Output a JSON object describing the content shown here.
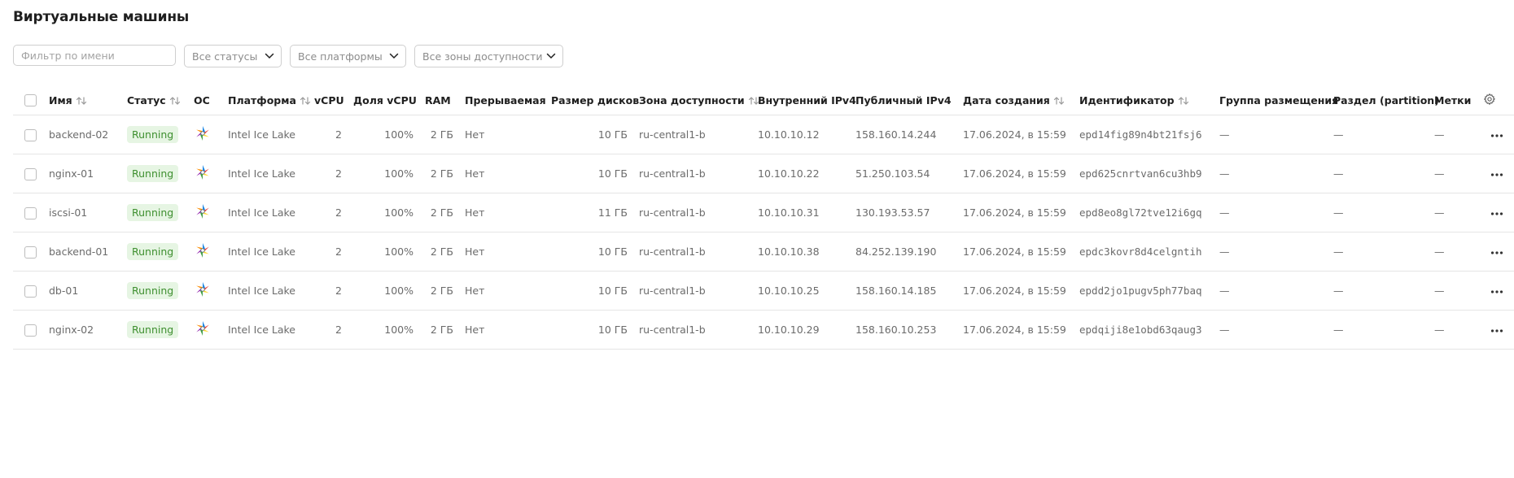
{
  "page": {
    "title": "Виртуальные машины"
  },
  "filters": {
    "name_placeholder": "Фильтр по имени",
    "status": "Все статусы",
    "platform": "Все платформы",
    "zone": "Все зоны доступности"
  },
  "columns": {
    "name": "Имя",
    "status": "Статус",
    "os": "ОС",
    "platform": "Платформа",
    "vcpu": "vCPU",
    "vcpu_share": "Доля vCPU",
    "ram": "RAM",
    "preemptible": "Прерываемая",
    "disk_size": "Размер дисков",
    "zone": "Зона доступности",
    "internal_ipv4": "Внутренний IPv4",
    "public_ipv4": "Публичный IPv4",
    "created": "Дата создания",
    "id": "Идентификатор",
    "placement_group": "Группа размещения",
    "partition": "Раздел (partition)",
    "labels": "Метки"
  },
  "rows": [
    {
      "name": "backend-02",
      "status": "Running",
      "platform": "Intel Ice Lake",
      "vcpu": "2",
      "vcpu_share": "100%",
      "ram": "2 ГБ",
      "preemptible": "Нет",
      "disk": "10 ГБ",
      "zone": "ru-central1-b",
      "internal_ip": "10.10.10.12",
      "public_ip": "158.160.14.244",
      "created": "17.06.2024, в 15:59",
      "id": "epd14fig89n4bt21fsj6",
      "placement_group": "—",
      "partition": "—",
      "labels": "—"
    },
    {
      "name": "nginx-01",
      "status": "Running",
      "platform": "Intel Ice Lake",
      "vcpu": "2",
      "vcpu_share": "100%",
      "ram": "2 ГБ",
      "preemptible": "Нет",
      "disk": "10 ГБ",
      "zone": "ru-central1-b",
      "internal_ip": "10.10.10.22",
      "public_ip": "51.250.103.54",
      "created": "17.06.2024, в 15:59",
      "id": "epd625cnrtvan6cu3hb9",
      "placement_group": "—",
      "partition": "—",
      "labels": "—"
    },
    {
      "name": "iscsi-01",
      "status": "Running",
      "platform": "Intel Ice Lake",
      "vcpu": "2",
      "vcpu_share": "100%",
      "ram": "2 ГБ",
      "preemptible": "Нет",
      "disk": "11 ГБ",
      "zone": "ru-central1-b",
      "internal_ip": "10.10.10.31",
      "public_ip": "130.193.53.57",
      "created": "17.06.2024, в 15:59",
      "id": "epd8eo8gl72tve12i6gq",
      "placement_group": "—",
      "partition": "—",
      "labels": "—"
    },
    {
      "name": "backend-01",
      "status": "Running",
      "platform": "Intel Ice Lake",
      "vcpu": "2",
      "vcpu_share": "100%",
      "ram": "2 ГБ",
      "preemptible": "Нет",
      "disk": "10 ГБ",
      "zone": "ru-central1-b",
      "internal_ip": "10.10.10.38",
      "public_ip": "84.252.139.190",
      "created": "17.06.2024, в 15:59",
      "id": "epdc3kovr8d4celgntih",
      "placement_group": "—",
      "partition": "—",
      "labels": "—"
    },
    {
      "name": "db-01",
      "status": "Running",
      "platform": "Intel Ice Lake",
      "vcpu": "2",
      "vcpu_share": "100%",
      "ram": "2 ГБ",
      "preemptible": "Нет",
      "disk": "10 ГБ",
      "zone": "ru-central1-b",
      "internal_ip": "10.10.10.25",
      "public_ip": "158.160.14.185",
      "created": "17.06.2024, в 15:59",
      "id": "epdd2jo1pugv5ph77baq",
      "placement_group": "—",
      "partition": "—",
      "labels": "—"
    },
    {
      "name": "nginx-02",
      "status": "Running",
      "platform": "Intel Ice Lake",
      "vcpu": "2",
      "vcpu_share": "100%",
      "ram": "2 ГБ",
      "preemptible": "Нет",
      "disk": "10 ГБ",
      "zone": "ru-central1-b",
      "internal_ip": "10.10.10.29",
      "public_ip": "158.160.10.253",
      "created": "17.06.2024, в 15:59",
      "id": "epdqiji8e1obd63qaug3",
      "placement_group": "—",
      "partition": "—",
      "labels": "—"
    }
  ],
  "icons": {
    "os": "os-logo-icon",
    "row_menu": "more-horizontal-icon",
    "settings": "gear-icon",
    "sort": "sort-arrows-icon",
    "dropdown": "chevron-down-icon"
  },
  "colors": {
    "status_bg": "#e6f5e3",
    "status_text": "#3e8f2f"
  }
}
